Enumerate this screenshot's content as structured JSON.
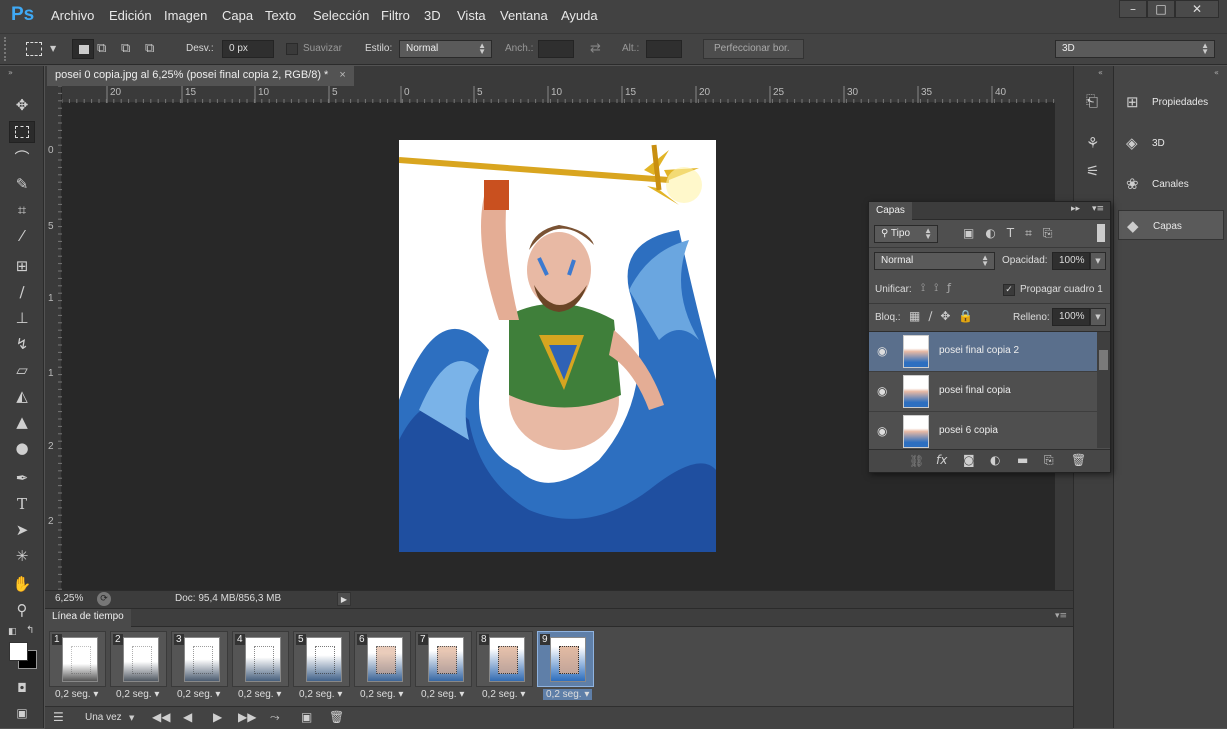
{
  "app": {
    "logo": "Ps"
  },
  "menu": [
    "Archivo",
    "Edición",
    "Imagen",
    "Capa",
    "Texto",
    "Selección",
    "Filtro",
    "3D",
    "Vista",
    "Ventana",
    "Ayuda"
  ],
  "window_controls": {
    "minimize": "–",
    "maximize": "□",
    "close": "✕"
  },
  "options": {
    "desv_label": "Desv.:",
    "desv_value": "0 px",
    "suavizar": "Suavizar",
    "estilo_label": "Estilo:",
    "estilo_value": "Normal",
    "anch_label": "Anch.:",
    "alt_label": "Alt.:",
    "refine_button": "Perfeccionar bor.",
    "workspace": "3D"
  },
  "document": {
    "tab_title": "posei 0 copia.jpg al 6,25% (posei final copia 2, RGB/8) *",
    "tab_close": "×"
  },
  "rulers": {
    "h_ticks": [
      "20",
      "15",
      "10",
      "5",
      "0",
      "5",
      "10",
      "15",
      "20",
      "25",
      "30",
      "35",
      "40"
    ],
    "v_ticks": [
      "0",
      "5",
      "1",
      "1",
      "2",
      "2"
    ]
  },
  "status": {
    "zoom": "6,25%",
    "doc": "Doc: 95,4 MB/856,3 MB"
  },
  "timeline": {
    "title": "Línea de tiempo",
    "frames": [
      {
        "num": "1",
        "delay": "0,2 seg."
      },
      {
        "num": "2",
        "delay": "0,2 seg."
      },
      {
        "num": "3",
        "delay": "0,2 seg."
      },
      {
        "num": "4",
        "delay": "0,2 seg."
      },
      {
        "num": "5",
        "delay": "0,2 seg."
      },
      {
        "num": "6",
        "delay": "0,2 seg."
      },
      {
        "num": "7",
        "delay": "0,2 seg."
      },
      {
        "num": "8",
        "delay": "0,2 seg."
      },
      {
        "num": "9",
        "delay": "0,2 seg."
      }
    ],
    "selected_frame": "9",
    "loop": "Una vez"
  },
  "dock": {
    "panels": [
      {
        "label": "Propiedades",
        "icon": "properties-icon"
      },
      {
        "label": "3D",
        "icon": "cube-icon"
      },
      {
        "label": "Canales",
        "icon": "channels-icon"
      },
      {
        "label": "Capas",
        "icon": "layers-icon"
      }
    ]
  },
  "layers_panel": {
    "title": "Capas",
    "filter": "Tipo",
    "blend_mode": "Normal",
    "opacity_label": "Opacidad:",
    "opacity": "100%",
    "unify_label": "Unificar:",
    "propagate": "Propagar cuadro 1",
    "lock_label": "Bloq.:",
    "fill_label": "Relleno:",
    "fill": "100%",
    "layers": [
      {
        "name": "posei final copia 2",
        "selected": true
      },
      {
        "name": "posei final copia",
        "selected": false
      },
      {
        "name": "posei 6 copia",
        "selected": false
      }
    ]
  },
  "colors": {
    "accent": "#3fa9f5",
    "selection": "#5a6f8c"
  }
}
